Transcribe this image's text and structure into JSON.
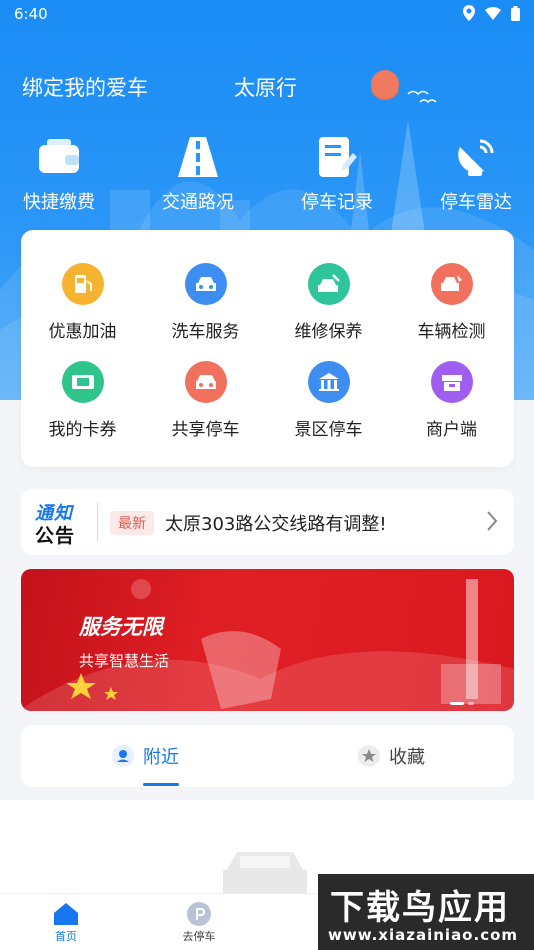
{
  "status_bar": {
    "time": "6:40"
  },
  "header": {
    "bind_car": "绑定我的爱车",
    "city_title": "太原行"
  },
  "quick_actions": [
    {
      "label": "快捷缴费",
      "icon": "wallet-icon"
    },
    {
      "label": "交通路况",
      "icon": "road-icon"
    },
    {
      "label": "停车记录",
      "icon": "document-edit-icon"
    },
    {
      "label": "停车雷达",
      "icon": "radar-dish-icon"
    }
  ],
  "services": [
    {
      "label": "优惠加油",
      "icon": "fuel-pump-icon",
      "color": "#f6b330"
    },
    {
      "label": "洗车服务",
      "icon": "car-wash-icon",
      "color": "#3d8ef0"
    },
    {
      "label": "维修保养",
      "icon": "car-repair-icon",
      "color": "#2fc49a"
    },
    {
      "label": "车辆检测",
      "icon": "car-inspection-icon",
      "color": "#f2705e"
    },
    {
      "label": "我的卡券",
      "icon": "coupon-icon",
      "color": "#2fc48a"
    },
    {
      "label": "共享停车",
      "icon": "shared-parking-icon",
      "color": "#f2705e"
    },
    {
      "label": "景区停车",
      "icon": "scenic-parking-icon",
      "color": "#3d8ef0"
    },
    {
      "label": "商户端",
      "icon": "merchant-icon",
      "color": "#a05ef0"
    }
  ],
  "notice": {
    "logo_top": "通知",
    "logo_bottom": "公告",
    "badge": "最新",
    "text": "太原303路公交线路有调整!"
  },
  "banner": {
    "title": "服务无限",
    "subtitle": "共享智慧生活"
  },
  "tabs": [
    {
      "label": "附近",
      "active": true
    },
    {
      "label": "收藏",
      "active": false
    }
  ],
  "bottom_nav": [
    {
      "label": "首页",
      "icon": "home-icon",
      "active": true
    },
    {
      "label": "去停车",
      "icon": "parking-icon",
      "active": false
    }
  ],
  "watermark": {
    "line1": "下载鸟应用",
    "line2": "www.xiazainiao.com"
  },
  "colors": {
    "primary": "#1677f0",
    "header": "#1a8cf5",
    "banner": "#d91820"
  }
}
